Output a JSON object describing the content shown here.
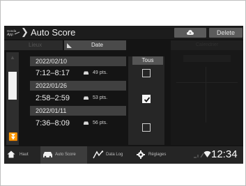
{
  "title": "Auto Score",
  "toolbar": {
    "delete_label": "Delete"
  },
  "sort_tabs": {
    "lieu": "Lieux",
    "date": "Date"
  },
  "right_panel": {
    "header": "Calendrier"
  },
  "column": {
    "tous_label": "Tous"
  },
  "entries": [
    {
      "date": "2022/02/10",
      "time": "7:12–8:17",
      "score": "49 pts.",
      "checked": false
    },
    {
      "date": "2022/01/26",
      "time": "2:58–2:59",
      "score": "53 pts.",
      "checked": true
    },
    {
      "date": "2022/01/11",
      "time": "7:36–8:09",
      "score": "56 pts.",
      "checked": false
    }
  ],
  "nav": [
    {
      "label": "Haut",
      "icon": "home-icon"
    },
    {
      "label": "Auto Score",
      "icon": "car-icon",
      "active": true
    },
    {
      "label": "Data Log",
      "icon": "data-log-icon"
    },
    {
      "label": "Réglages",
      "icon": "gear-icon"
    }
  ],
  "status": {
    "clock": "12:34"
  }
}
